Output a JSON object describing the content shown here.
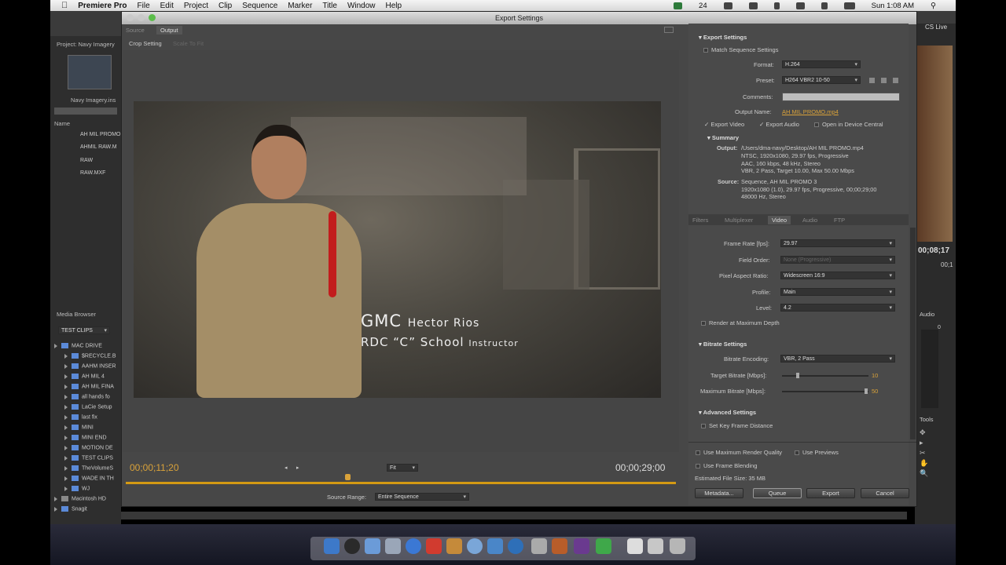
{
  "menubar": {
    "items": [
      "Premiere Pro",
      "File",
      "Edit",
      "Project",
      "Clip",
      "Sequence",
      "Marker",
      "Title",
      "Window",
      "Help"
    ],
    "clock": "Sun 1:08 AM",
    "battery_num": "24"
  },
  "workspace": {
    "cs_live": "CS Live"
  },
  "project": {
    "title": "Project: Navy Imagery",
    "bin_label": "Navy Imagery.ins",
    "name_header": "Name",
    "items": [
      "AH MIL PROMO",
      "AHMIL RAW.M",
      "RAW",
      "RAW.MXF"
    ]
  },
  "media_browser": {
    "tab": "Media Browser",
    "filter": "TEST CLIPS",
    "tree": [
      "MAC DRIVE",
      "$RECYCLE.B",
      "AAHM INSER",
      "AH MIL 4",
      "AH MIL FINA",
      "all hands fo",
      "LaCie Setup",
      "last fix",
      "MINI",
      "MINI END",
      "MOTION DE",
      "TEST CLIPS",
      "TheVolumeS",
      "WADE IN TH",
      "WJ",
      "Macintosh HD",
      "Snagit"
    ]
  },
  "dialog": {
    "title": "Export Settings",
    "tabs": {
      "source": "Source",
      "output": "Output"
    },
    "crop_label": "Crop Setting",
    "crop_value": "Scale To Fit",
    "lower_third": {
      "name1": "GMC",
      "name2": "Hector Rios",
      "title1": "RDC",
      "title2": "“C” School",
      "title3": "Instructor"
    },
    "timecode_current": "00;00;11;20",
    "timecode_end": "00;00;29;00",
    "zoom": "Fit",
    "source_range_label": "Source Range:",
    "source_range_value": "Entire Sequence"
  },
  "export_settings": {
    "header": "Export Settings",
    "match_sequence": "Match Sequence Settings",
    "format_label": "Format:",
    "format_value": "H.264",
    "preset_label": "Preset:",
    "preset_value": "H264 VBR2 10-50",
    "comments_label": "Comments:",
    "output_name_label": "Output Name:",
    "output_name_value": "AH MIL PROMO.mp4",
    "export_video": "Export Video",
    "export_audio": "Export Audio",
    "open_device": "Open in Device Central",
    "summary_header": "Summary",
    "output_label": "Output:",
    "output_lines": [
      "/Users/dma-navy/Desktop/AH MIL PROMO.mp4",
      "NTSC, 1920x1080, 29.97 fps, Progressive",
      "AAC, 160 kbps, 48 kHz, Stereo",
      "VBR, 2 Pass, Target 10.00, Max 50.00 Mbps"
    ],
    "source_label": "Source:",
    "source_lines": [
      "Sequence, AH MIL PROMO 3",
      "1920x1080 (1.0), 29.97 fps, Progressive, 00;00;29;00",
      "48000 Hz, Stereo"
    ]
  },
  "settings_tabs": [
    "Filters",
    "Multiplexer",
    "Video",
    "Audio",
    "FTP"
  ],
  "video": {
    "frame_rate_label": "Frame Rate [fps]:",
    "frame_rate_value": "29.97",
    "field_order_label": "Field Order:",
    "field_order_value": "None (Progressive)",
    "par_label": "Pixel Aspect Ratio:",
    "par_value": "Widescreen 16:9",
    "profile_label": "Profile:",
    "profile_value": "Main",
    "level_label": "Level:",
    "level_value": "4.2",
    "render_max": "Render at Maximum Depth",
    "bitrate_header": "Bitrate Settings",
    "encoding_label": "Bitrate Encoding:",
    "encoding_value": "VBR, 2 Pass",
    "target_label": "Target Bitrate [Mbps]:",
    "target_value": "10",
    "max_label": "Maximum Bitrate [Mbps]:",
    "max_value": "50",
    "advanced_header": "Advanced Settings",
    "keyframe": "Set Key Frame Distance"
  },
  "footer": {
    "max_render": "Use Maximum Render Quality",
    "previews": "Use Previews",
    "frame_blending": "Use Frame Blending",
    "file_size": "Estimated File Size:  35 MB",
    "metadata": "Metadata...",
    "queue": "Queue",
    "export": "Export",
    "cancel": "Cancel"
  },
  "right_panels": {
    "timecode": "00;08;17",
    "timecode2": "00;1",
    "audio": "Audio",
    "audio_val": "0",
    "tools": "Tools"
  }
}
